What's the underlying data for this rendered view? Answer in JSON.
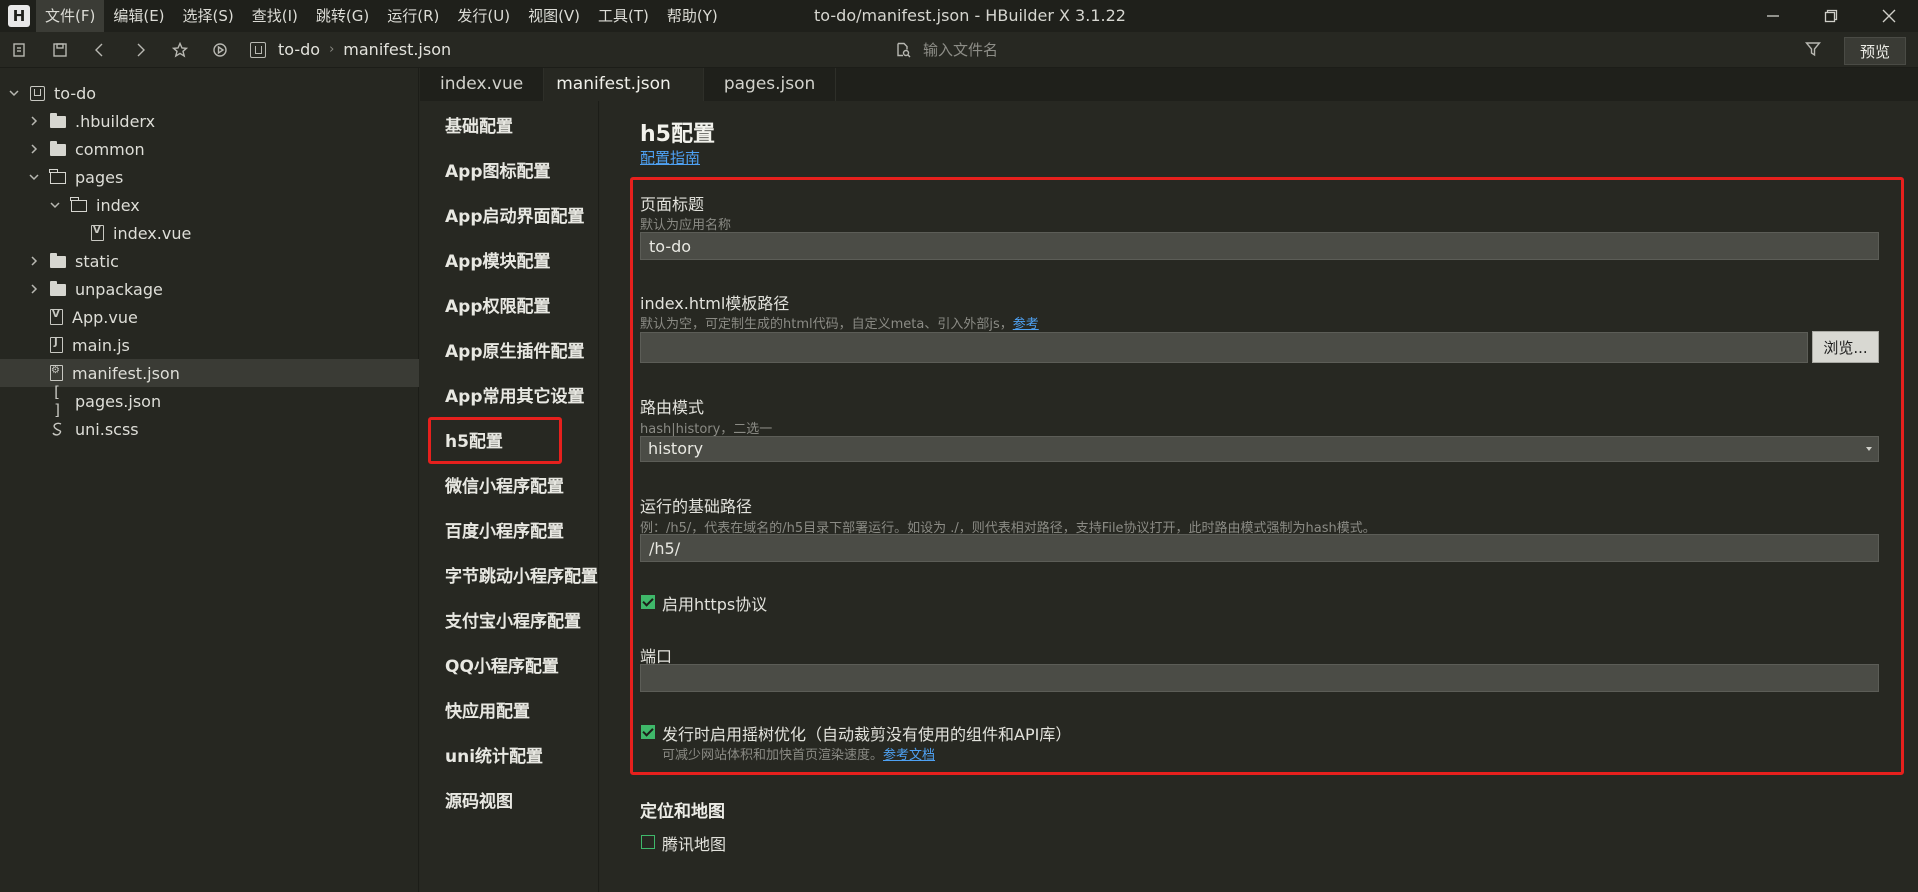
{
  "window": {
    "title": "to-do/manifest.json - HBuilder X 3.1.22"
  },
  "menu": [
    {
      "label": "文件(F)",
      "active": true
    },
    {
      "label": "编辑(E)"
    },
    {
      "label": "选择(S)"
    },
    {
      "label": "查找(I)"
    },
    {
      "label": "跳转(G)"
    },
    {
      "label": "运行(R)"
    },
    {
      "label": "发行(U)"
    },
    {
      "label": "视图(V)"
    },
    {
      "label": "工具(T)"
    },
    {
      "label": "帮助(Y)"
    }
  ],
  "toolbar": {
    "breadcrumb": [
      "to-do",
      "manifest.json"
    ],
    "file_search_placeholder": "输入文件名",
    "preview_label": "预览"
  },
  "tree": [
    {
      "label": "to-do",
      "kind": "project",
      "arrow": "down",
      "level": 0
    },
    {
      "label": ".hbuilderx",
      "kind": "folder",
      "arrow": "right",
      "level": 1
    },
    {
      "label": "common",
      "kind": "folder",
      "arrow": "right",
      "level": 1
    },
    {
      "label": "pages",
      "kind": "folder-open",
      "arrow": "down",
      "level": 1
    },
    {
      "label": "index",
      "kind": "folder-open",
      "arrow": "down",
      "level": 2
    },
    {
      "label": "index.vue",
      "kind": "file-vue",
      "arrow": "none",
      "level": 3
    },
    {
      "label": "static",
      "kind": "folder",
      "arrow": "right",
      "level": 1
    },
    {
      "label": "unpackage",
      "kind": "folder",
      "arrow": "right",
      "level": 1
    },
    {
      "label": "App.vue",
      "kind": "file-vue",
      "arrow": "none",
      "level": 1
    },
    {
      "label": "main.js",
      "kind": "file-js",
      "arrow": "none",
      "level": 1
    },
    {
      "label": "manifest.json",
      "kind": "file-gear",
      "arrow": "none",
      "level": 1,
      "selected": true
    },
    {
      "label": "pages.json",
      "kind": "brackets",
      "arrow": "none",
      "level": 1
    },
    {
      "label": "uni.scss",
      "kind": "scss",
      "arrow": "none",
      "level": 1
    }
  ],
  "tabs": [
    {
      "label": "index.vue"
    },
    {
      "label": "manifest.json",
      "active": true
    },
    {
      "label": "pages.json"
    }
  ],
  "config_nav": [
    "基础配置",
    "App图标配置",
    "App启动界面配置",
    "App模块配置",
    "App权限配置",
    "App原生插件配置",
    "App常用其它设置",
    "h5配置",
    "微信小程序配置",
    "百度小程序配置",
    "字节跳动小程序配置",
    "支付宝小程序配置",
    "QQ小程序配置",
    "快应用配置",
    "uni统计配置",
    "源码视图"
  ],
  "config_nav_selected": "h5配置",
  "form": {
    "title": "h5配置",
    "guide_link": "配置指南",
    "page_title": {
      "label": "页面标题",
      "hint": "默认为应用名称",
      "value": "to-do"
    },
    "template_path": {
      "label": "index.html模板路径",
      "hint": "默认为空，可定制生成的html代码，自定义meta、引入外部js，",
      "hint_link": "参考",
      "value": "",
      "browse_label": "浏览..."
    },
    "router_mode": {
      "label": "路由模式",
      "hint": "hash|history，二选一",
      "value": "history"
    },
    "base_path": {
      "label": "运行的基础路径",
      "hint": "例：/h5/，代表在域名的/h5目录下部署运行。如设为 ./，则代表相对路径，支持File协议打开，此时路由模式强制为hash模式。",
      "value": "/h5/"
    },
    "https": {
      "label": "启用https协议",
      "checked": true
    },
    "port": {
      "label": "端口",
      "value": ""
    },
    "tree_shaking": {
      "label": "发行时启用摇树优化（自动裁剪没有使用的组件和API库）",
      "hint": "可减少网站体积和加快首页渲染速度。",
      "hint_link": "参考文档",
      "checked": true
    },
    "map_section_title": "定位和地图",
    "tencent_map": {
      "label": "腾讯地图",
      "checked": false
    }
  },
  "colors": {
    "highlight": "#e6201d",
    "link": "#4ea1f3",
    "check": "#3fb86a"
  }
}
